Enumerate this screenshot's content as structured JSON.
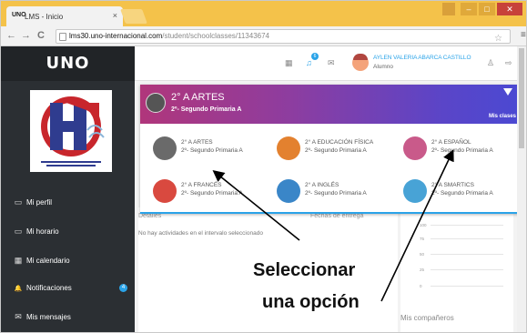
{
  "browser": {
    "tab_title": "LMS - Inicio",
    "tab_favicon": "UNO",
    "tab_close": "×",
    "url_host": "lms30.uno-internacional.com",
    "url_path": "/student/schoolclasses/11343674",
    "nav_icons": [
      "back-icon",
      "forward-icon",
      "reload-icon"
    ],
    "nav_back": "←",
    "nav_forward": "→",
    "nav_reload": "C",
    "bookmark_star": "☆",
    "menu_glyph": "≡",
    "window_controls": [
      "user-icon",
      "minimize-icon",
      "maximize-icon",
      "close-icon"
    ],
    "win_min": "–",
    "win_max": "□",
    "win_close": "✕"
  },
  "app": {
    "logo": "UNO",
    "school_logo_text": "COLEGIO DE CIENCIAS Y LETRAS DE MINAS"
  },
  "sidebar": {
    "items": [
      {
        "label": "Mi perfil",
        "icon": "id-card-icon",
        "glyph": "▭"
      },
      {
        "label": "Mi horario",
        "icon": "calendar-icon",
        "glyph": "▭"
      },
      {
        "label": "Mi calendario",
        "icon": "calendar-grid-icon",
        "glyph": "▦"
      },
      {
        "label": "Notificaciones",
        "icon": "bell-icon",
        "glyph": "🔔",
        "badge": "4"
      },
      {
        "label": "Mis mensajes",
        "icon": "envelope-icon",
        "glyph": "✉"
      }
    ]
  },
  "header": {
    "icons": [
      "calendar-icon",
      "notification-icon",
      "mail-icon"
    ],
    "notification_count": "6",
    "glyph_calendar": "▦",
    "glyph_bell": "♫",
    "glyph_mail": "✉",
    "user_name": "AYLEN VALERIA ABARCA CASTILLO",
    "user_role": "Alumno",
    "tools_icon": "♙",
    "logout_icon": "⇨"
  },
  "popup": {
    "title": "2° A ARTES",
    "subtitle": "2º- Segundo Primaria A",
    "link": "Mis clases",
    "courses": [
      {
        "name": "2° A ARTES",
        "group": "2º- Segundo Primaria A",
        "color": "#6a6a6a"
      },
      {
        "name": "2° A EDUCACIÓN FÍSICA",
        "group": "2º- Segundo Primaria A",
        "color": "#e3812f"
      },
      {
        "name": "2° A ESPAÑOL",
        "group": "2º- Segundo Primaria A",
        "color": "#c95a8a"
      },
      {
        "name": "2° A FRANCÉS",
        "group": "2º- Segundo Primaria A",
        "color": "#d9493f"
      },
      {
        "name": "2° A INGLÉS",
        "group": "2º- Segundo Primaria A",
        "color": "#3a86c8"
      },
      {
        "name": "2° A SMARTICS",
        "group": "2º- Segundo Primaria A",
        "color": "#48a3d6"
      }
    ]
  },
  "content": {
    "col_detalles": "Detalles",
    "col_fechas": "Fechas de entrega",
    "empty_message": "No hay actividades en el intervalo seleccionado",
    "chart_ticks": [
      "100",
      "75",
      "50",
      "25",
      "0"
    ],
    "companeros": "Mis compañeros"
  },
  "annotation": {
    "line1": "Seleccionar",
    "line2": "una opción"
  }
}
